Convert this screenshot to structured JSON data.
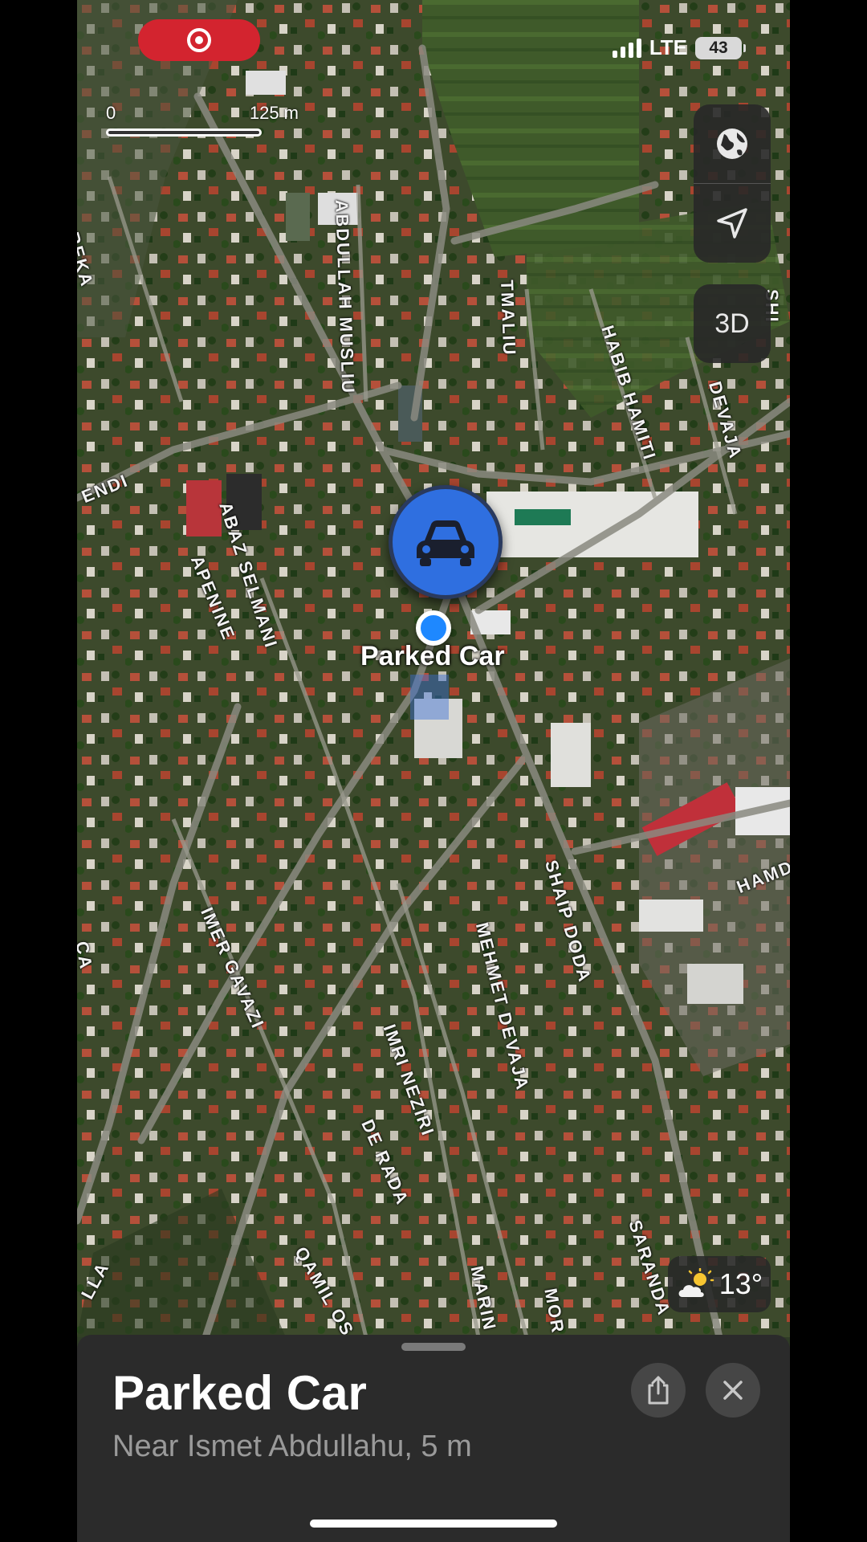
{
  "status_bar": {
    "network": "LTE",
    "battery": "43",
    "recording": true
  },
  "map": {
    "scale": {
      "zero": "0",
      "max": "125 m"
    },
    "streets": [
      "ABDULLAH MUSLIU",
      "TMALIU",
      "HABIB HAMITI",
      "DEVAJA",
      "REKA",
      "ENDI",
      "ABAZ SELMANI",
      "APENINE",
      "SHAIP DODA",
      "MEHMET DEVAJA",
      "IMER GAVAZI",
      "IMRI NEZIRI",
      "DE RADA",
      "QAMIL OS",
      "MARIN",
      "MOR",
      "SARANDA",
      "HAMDI",
      "LLA",
      "CA",
      "SHI"
    ],
    "controls": {
      "globe_icon": "globe-icon",
      "locate_icon": "location-arrow-icon",
      "three_d": "3D"
    },
    "marker": {
      "icon": "car-icon",
      "label": "Parked Car"
    },
    "weather": {
      "icon": "partly-sunny-icon",
      "temperature": "13°"
    }
  },
  "sheet": {
    "title": "Parked Car",
    "subtitle": "Near Ismet Abdullahu, 5 m",
    "share_icon": "share-icon",
    "close_icon": "close-icon"
  },
  "colors": {
    "recording": "#d3242f",
    "marker": "#2f6fe0",
    "user_location": "#1e88ff",
    "sheet_bg": "#2b2b2b"
  }
}
